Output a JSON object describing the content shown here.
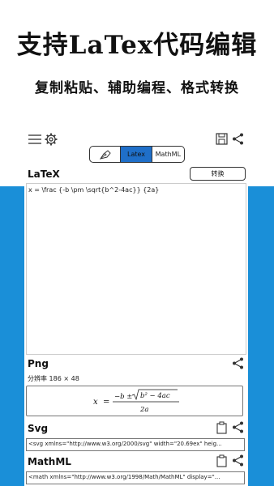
{
  "banner": {
    "title": "支持LaTex代码编辑",
    "subtitle": "复制粘贴、辅助编程、格式转换"
  },
  "toolbar": {
    "menu_icon": "hamburger-menu-icon",
    "settings_icon": "gear-icon",
    "save_icon": "save-icon",
    "share_icon": "share-icon"
  },
  "mode_tabs": {
    "pen_icon": "pen-nib-icon",
    "latex": "Latex",
    "mathml": "MathML",
    "active": "Latex",
    "active_color": "#1f6fc9"
  },
  "latex_section": {
    "label": "LaTeX",
    "convert_label": "转换",
    "input_value": "x = \\frac {-b \\pm \\sqrt{b^2-4ac}} {2a}"
  },
  "png_section": {
    "label": "Png",
    "resolution": "分辨率  186 × 48",
    "formula": {
      "lhs": "x",
      "eq": "=",
      "num_prefix": "−b ±",
      "radicand": "b² − 4ac",
      "denominator": "2a"
    }
  },
  "svg_section": {
    "label": "Svg",
    "code": "<svg xmlns=\"http://www.w3.org/2000/svg\" width=\"20.69ex\" heig..."
  },
  "mathml_section": {
    "label": "MathML",
    "code": "<math xmlns=\"http://www.w3.org/1998/Math/MathML\" display=\"..."
  },
  "colors": {
    "accent_blue": "#1a8fd8"
  }
}
